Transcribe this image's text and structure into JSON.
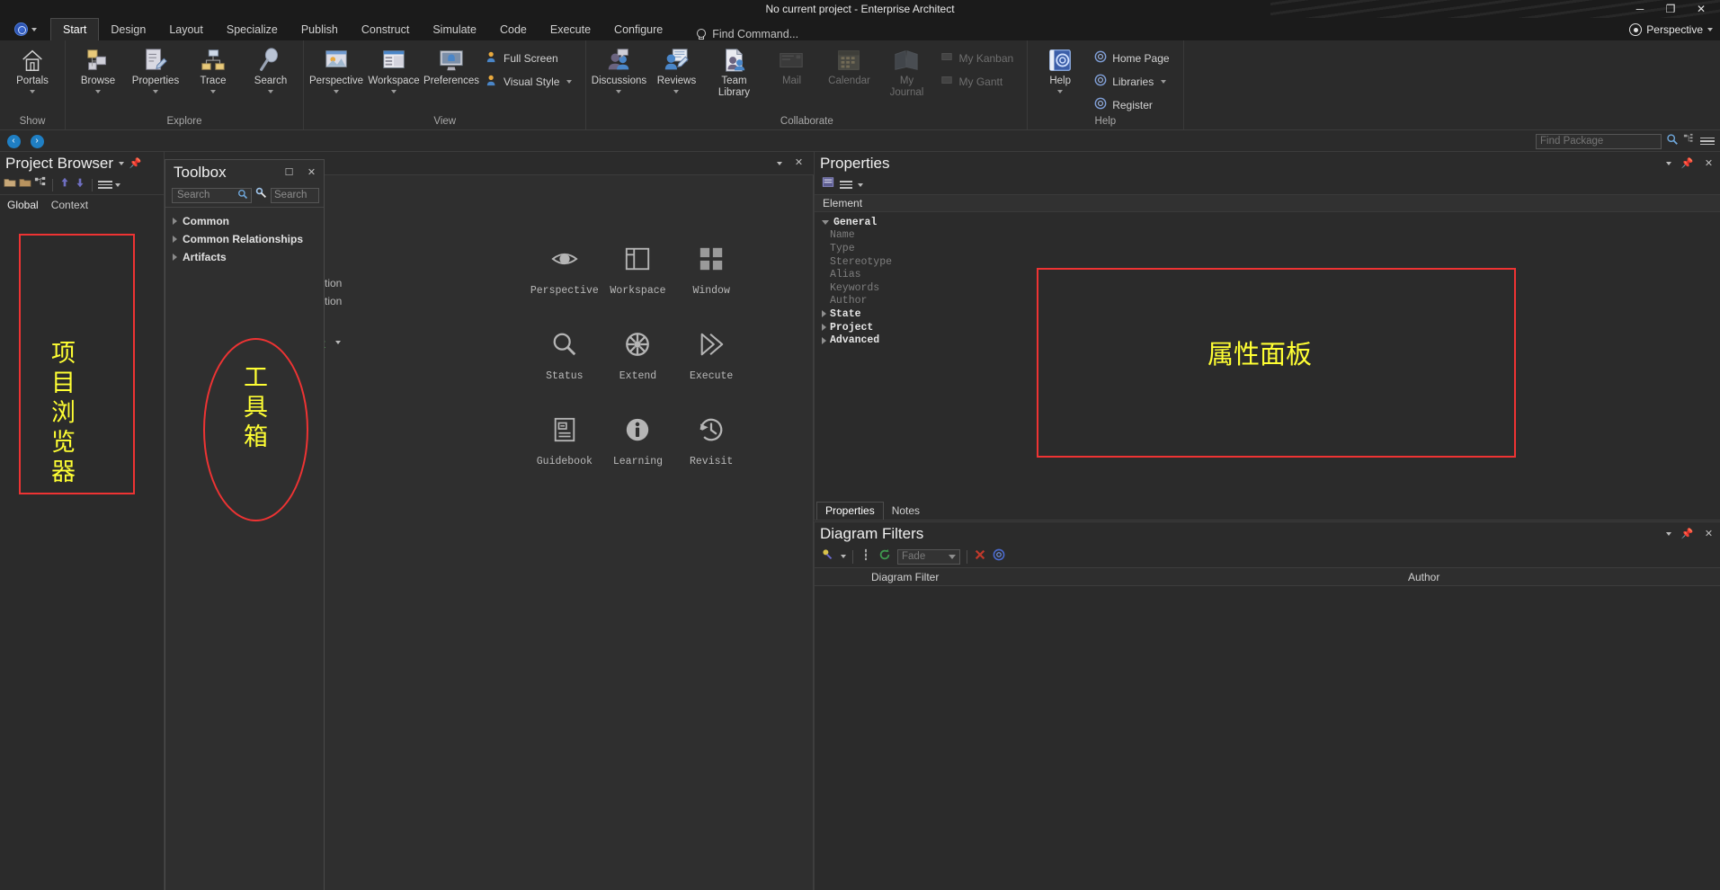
{
  "window": {
    "title": "No current project - Enterprise Architect",
    "minimize": "─",
    "maximize": "❐",
    "close": "✕",
    "perspective_label": "Perspective"
  },
  "ribbon": {
    "tabs": [
      {
        "label": "Start",
        "active": true
      },
      {
        "label": "Design",
        "active": false
      },
      {
        "label": "Layout",
        "active": false
      },
      {
        "label": "Specialize",
        "active": false
      },
      {
        "label": "Publish",
        "active": false
      },
      {
        "label": "Construct",
        "active": false
      },
      {
        "label": "Simulate",
        "active": false
      },
      {
        "label": "Code",
        "active": false
      },
      {
        "label": "Execute",
        "active": false
      },
      {
        "label": "Configure",
        "active": false
      }
    ],
    "find_command": "Find Command...",
    "groups": [
      {
        "name": "Show",
        "label": "Show",
        "buttons": [
          {
            "label": "Portals",
            "icon": "portals-icon",
            "dropdown": true,
            "dim": false
          }
        ]
      },
      {
        "name": "Explore",
        "label": "Explore",
        "buttons": [
          {
            "label": "Browse",
            "icon": "browse-icon",
            "dropdown": true,
            "dim": false
          },
          {
            "label": "Properties",
            "icon": "properties-icon",
            "dropdown": true,
            "dim": false
          },
          {
            "label": "Trace",
            "icon": "trace-icon",
            "dropdown": true,
            "dim": false
          },
          {
            "label": "Search",
            "icon": "search-icon",
            "dropdown": true,
            "dim": false
          }
        ]
      },
      {
        "name": "View",
        "label": "View",
        "buttons": [
          {
            "label": "Perspective",
            "icon": "perspective-icon",
            "dropdown": true,
            "dim": false
          },
          {
            "label": "Workspace",
            "icon": "workspace-icon",
            "dropdown": true,
            "dim": false
          },
          {
            "label": "Preferences",
            "icon": "preferences-icon",
            "dropdown": false,
            "dim": false
          }
        ],
        "small_buttons": [
          {
            "label": "Full Screen",
            "icon": "full-screen-icon",
            "dropdown": false,
            "dim": false
          },
          {
            "label": "Visual Style",
            "icon": "visual-style-icon",
            "dropdown": true,
            "dim": false
          }
        ]
      },
      {
        "name": "Collaborate",
        "label": "Collaborate",
        "buttons": [
          {
            "label": "Discussions",
            "icon": "discussions-icon",
            "dropdown": true,
            "dim": false
          },
          {
            "label": "Reviews",
            "icon": "reviews-icon",
            "dropdown": true,
            "dim": false
          },
          {
            "label": "Team\nLibrary",
            "icon": "team-library-icon",
            "dropdown": false,
            "dim": false
          },
          {
            "label": "Mail",
            "icon": "mail-icon",
            "dropdown": false,
            "dim": true
          },
          {
            "label": "Calendar",
            "icon": "calendar-icon",
            "dropdown": false,
            "dim": true
          },
          {
            "label": "My\nJournal",
            "icon": "my-journal-icon",
            "dropdown": false,
            "dim": true
          }
        ],
        "small_buttons": [
          {
            "label": "My Kanban",
            "icon": "my-kanban-icon",
            "dropdown": false,
            "dim": true
          },
          {
            "label": "My Gantt",
            "icon": "my-gantt-icon",
            "dropdown": false,
            "dim": true
          }
        ]
      },
      {
        "name": "Help",
        "label": "Help",
        "buttons": [
          {
            "label": "Help",
            "icon": "help-icon",
            "dropdown": true,
            "dim": false
          }
        ],
        "small_buttons": [
          {
            "label": "Home Page",
            "icon": "home-page-icon",
            "dropdown": false,
            "dim": false
          },
          {
            "label": "Libraries",
            "icon": "libraries-icon",
            "dropdown": true,
            "dim": false
          },
          {
            "label": "Register",
            "icon": "register-icon",
            "dropdown": false,
            "dim": false
          }
        ]
      }
    ]
  },
  "package_bar": {
    "back": "‹",
    "forward": "›",
    "find_package_placeholder": "Find Package"
  },
  "project_browser": {
    "title": "Project Browser",
    "tabs": [
      {
        "label": "Global",
        "selected": true
      },
      {
        "label": "Context",
        "selected": false
      }
    ],
    "toolbar_icons": [
      "new-model-icon",
      "new-package-icon",
      "new-diagram-icon",
      "move-up-icon",
      "move-down-icon",
      "menu-icon"
    ]
  },
  "toolbox": {
    "title": "Toolbox",
    "search_placeholder": "Search",
    "search2_placeholder": "Search",
    "groups": [
      {
        "label": "Common"
      },
      {
        "label": "Common Relationships"
      },
      {
        "label": "Artifacts"
      }
    ]
  },
  "diagram": {
    "hidden_text_1": "ction",
    "hidden_text_2": "ction",
    "hidden_text_3": "t",
    "portals": [
      {
        "label": "Perspective",
        "icon": "eye-icon"
      },
      {
        "label": "Workspace",
        "icon": "layout-icon"
      },
      {
        "label": "Window",
        "icon": "grid-icon"
      },
      {
        "label": "Status",
        "icon": "magnifier-icon"
      },
      {
        "label": "Extend",
        "icon": "gear-wheel-icon"
      },
      {
        "label": "Execute",
        "icon": "double-chevron-icon"
      },
      {
        "label": "Guidebook",
        "icon": "book-icon"
      },
      {
        "label": "Learning",
        "icon": "info-icon"
      },
      {
        "label": "Revisit",
        "icon": "clock-back-icon"
      }
    ]
  },
  "properties": {
    "title": "Properties",
    "element_label": "Element",
    "rows": [
      {
        "label": "General",
        "kind": "group",
        "expanded": true
      },
      {
        "label": "Name",
        "kind": "field"
      },
      {
        "label": "Type",
        "kind": "field"
      },
      {
        "label": "Stereotype",
        "kind": "field"
      },
      {
        "label": "Alias",
        "kind": "field"
      },
      {
        "label": "Keywords",
        "kind": "field"
      },
      {
        "label": "Author",
        "kind": "field"
      },
      {
        "label": "State",
        "kind": "group",
        "expanded": false
      },
      {
        "label": "Project",
        "kind": "group",
        "expanded": false
      },
      {
        "label": "Advanced",
        "kind": "group",
        "expanded": false
      }
    ],
    "tabs": [
      {
        "label": "Properties",
        "selected": true
      },
      {
        "label": "Notes",
        "selected": false
      }
    ]
  },
  "diagram_filters": {
    "title": "Diagram Filters",
    "mode_value": "Fade",
    "columns": [
      "Diagram Filter",
      "Author"
    ],
    "rows": []
  },
  "annotations": [
    {
      "name": "project-browser-annotation",
      "text": "项目浏览器",
      "shape": "rect"
    },
    {
      "name": "toolbox-annotation",
      "text": "工具箱",
      "shape": "ellipse"
    },
    {
      "name": "properties-annotation",
      "text": "属性面板",
      "shape": "rect"
    }
  ],
  "colors": {
    "accent_red": "#ee3333",
    "accent_yellow": "#ffff33",
    "panel_bg": "#2b2b2b",
    "blue": "#1f7fc4"
  }
}
